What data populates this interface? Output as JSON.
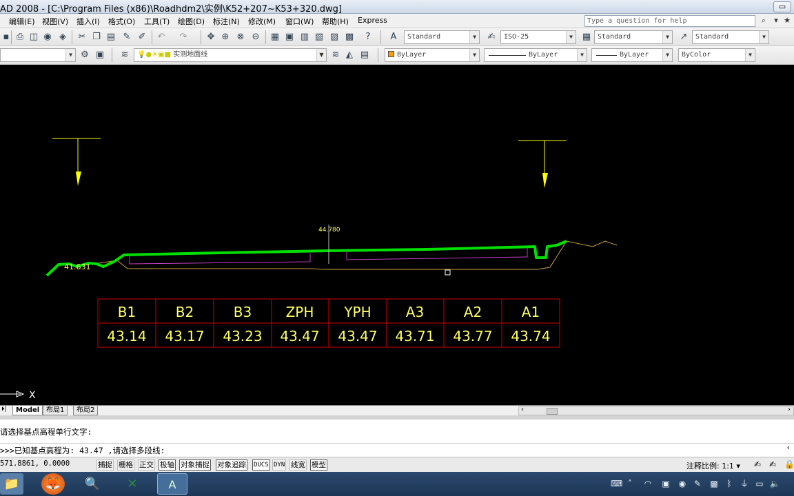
{
  "window": {
    "title": "AD 2008 - [C:\\Program Files (x86)\\Roadhdm2\\实例\\K52+207~K53+320.dwg]",
    "control_glyph": "▭"
  },
  "menu": {
    "items": [
      "编辑(E)",
      "视图(V)",
      "插入(I)",
      "格式(O)",
      "工具(T)",
      "绘图(D)",
      "标注(N)",
      "修改(M)",
      "窗口(W)",
      "帮助(H)",
      "Express"
    ]
  },
  "help": {
    "placeholder": "Type a question for help"
  },
  "toolbar1": {
    "text_style": "Standard",
    "dim_style": "ISO-25",
    "table_style": "Standard",
    "multileader_style": "Standard"
  },
  "toolbar2": {
    "layer": "实测地面线",
    "color": "ByLayer",
    "linetype": "ByLayer",
    "lineweight": "ByLayer",
    "plotstyle": "ByColor"
  },
  "drawing": {
    "center_label": "44.780",
    "left_label": "41.631",
    "axis_label": "X",
    "table": {
      "headers": [
        "B1",
        "B2",
        "B3",
        "ZPH",
        "YPH",
        "A3",
        "A2",
        "A1"
      ],
      "values": [
        "43.14",
        "43.17",
        "43.23",
        "43.47",
        "43.47",
        "43.71",
        "43.77",
        "43.74"
      ]
    },
    "colors": {
      "ground_line": "#00e000",
      "design_line": "#c040c0",
      "survey_line": "#c8a040",
      "table_border": "#d00000",
      "table_text": "#ffff66",
      "marker": "#ffff00"
    }
  },
  "tabs": [
    "Model",
    "布局1",
    "布局2"
  ],
  "command": {
    "line1": "请选择基点高程单行文字:",
    "line2": ">>>已知基点高程为: 43.47 ,请选择多段线:"
  },
  "status": {
    "coords": "571.8861, 0.0000",
    "buttons": [
      "捕捉",
      "栅格",
      "正交",
      "极轴",
      "对象捕捉",
      "对象追踪",
      "DUCS",
      "DYN",
      "线宽",
      "模型"
    ],
    "annotation_scale_label": "注释比例:",
    "annotation_scale": "1:1"
  }
}
